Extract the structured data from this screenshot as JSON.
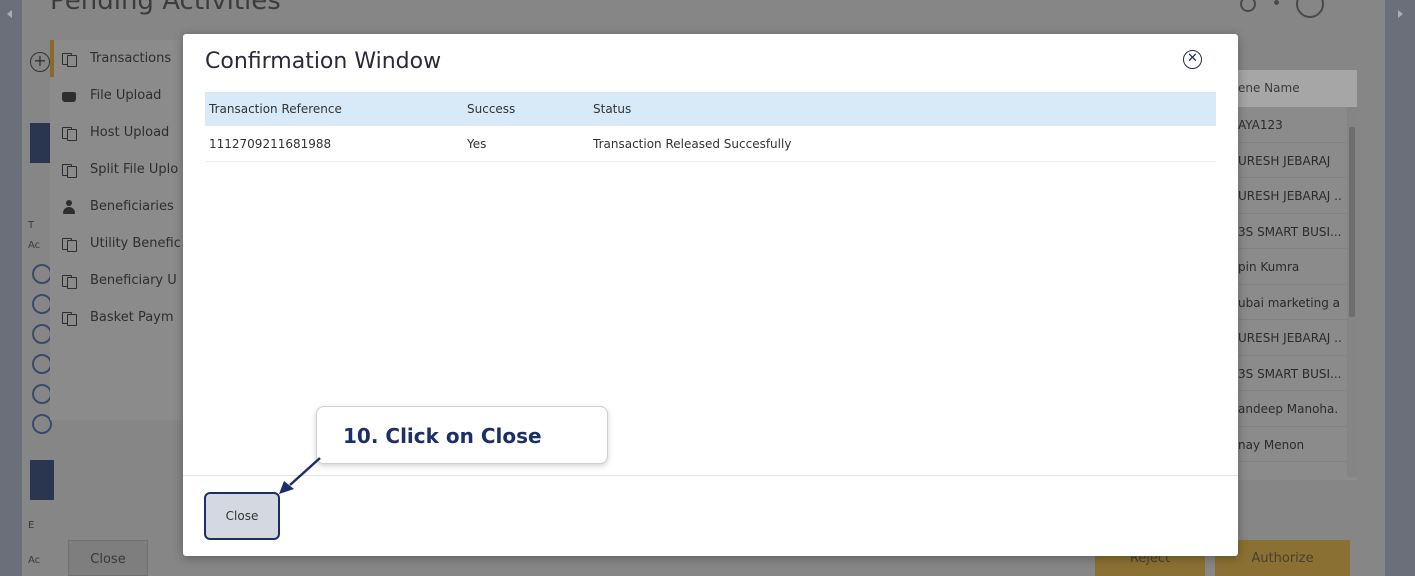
{
  "background": {
    "page_title": "Pending Activities",
    "menu": [
      {
        "label": "Transactions",
        "icon": "documents-icon",
        "active": true
      },
      {
        "label": "File Upload",
        "icon": "folder-icon"
      },
      {
        "label": "Host Upload",
        "icon": "documents-icon"
      },
      {
        "label": "Split File Uplo",
        "icon": "documents-icon"
      },
      {
        "label": "Beneficiaries",
        "icon": "person-icon"
      },
      {
        "label": "Utility Benefic",
        "icon": "documents-icon"
      },
      {
        "label": "Beneficiary U",
        "icon": "documents-icon"
      },
      {
        "label": "Basket Paym",
        "icon": "documents-icon"
      }
    ],
    "right_column": {
      "header": "ene Name",
      "rows": [
        "AYA123",
        "URESH JEBARAJ",
        "URESH JEBARAJ ..",
        "3S SMART BUSI...",
        "pin Kumra",
        "ubai marketing a",
        "URESH JEBARAJ ..",
        "3S SMART BUSI...",
        "andeep Manoha.",
        "nay Menon"
      ]
    },
    "buttons": {
      "close": "Close",
      "reject": "Reject",
      "authorize": "Authorize"
    }
  },
  "modal": {
    "title": "Confirmation Window",
    "columns": [
      "Transaction Reference",
      "Success",
      "Status"
    ],
    "rows": [
      {
        "reference": "1112709211681988",
        "success": "Yes",
        "status": "Transaction Released Succesfully"
      }
    ],
    "close_label": "Close"
  },
  "callout": {
    "text": "10.  Click on Close"
  },
  "colors": {
    "accent_navy": "#1c2f66",
    "table_header": "#d8eaf8",
    "overlay_gold": "#8a7032"
  }
}
